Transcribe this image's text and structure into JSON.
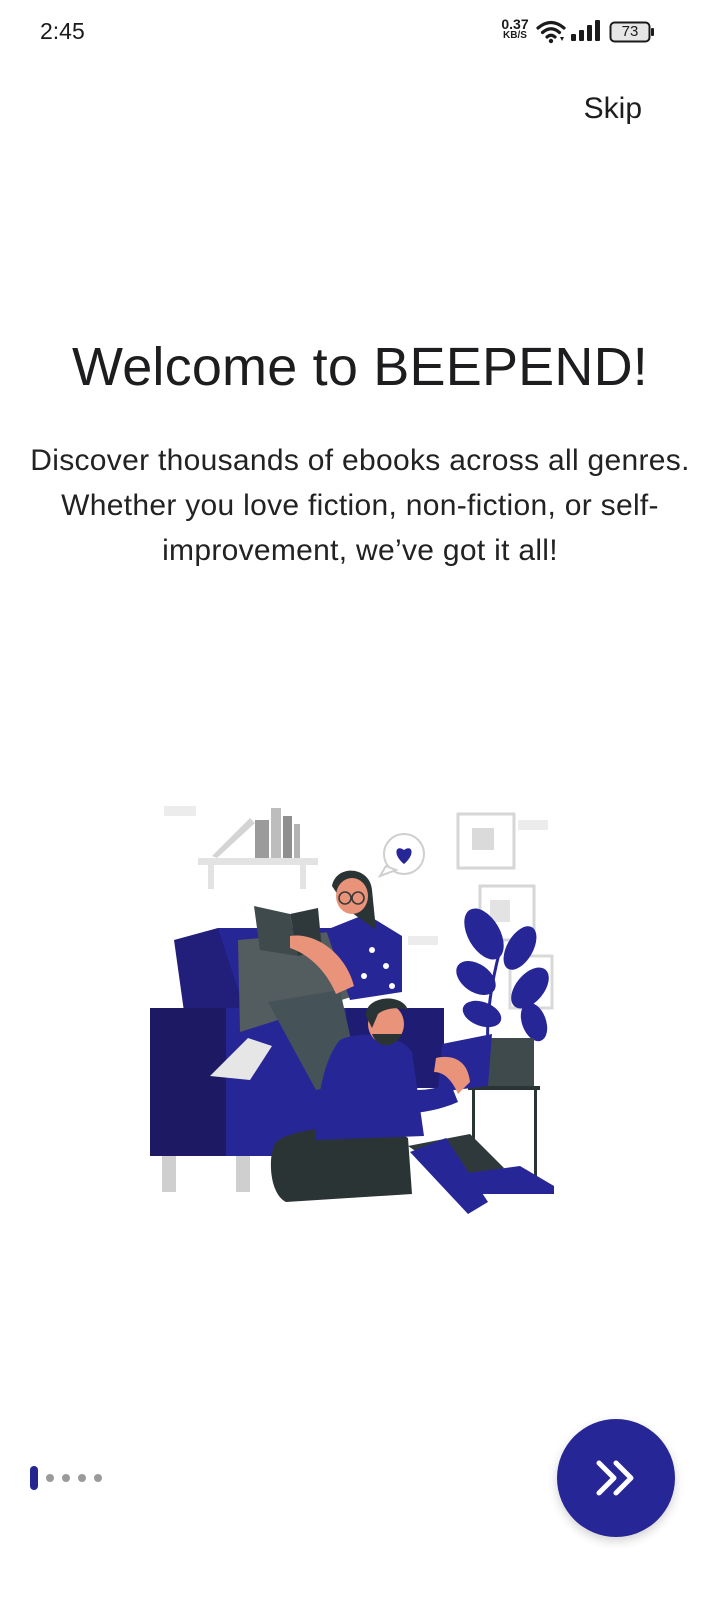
{
  "status_bar": {
    "time": "2:45",
    "net_speed_value": "0.37",
    "net_speed_unit": "KB/S",
    "battery_level": "73",
    "icons": [
      "wifi-icon",
      "signal-icon",
      "battery-icon"
    ]
  },
  "onboarding": {
    "skip_label": "Skip",
    "title": "Welcome to BEEPEND!",
    "description": "Discover thousands of ebooks across all genres. Whether you love fiction, non-fiction, or self-improvement, we’ve got it all!",
    "illustration": "reading-couple-illustration",
    "page_indicator": {
      "current": 1,
      "total": 5
    },
    "next_button_icon": "double-chevron-right-icon"
  },
  "colors": {
    "accent": "#272696",
    "accent_dark": "#1f1c74",
    "text": "#1d1d1f",
    "inactive_dot": "#9a9a9a",
    "background": "#ffffff"
  }
}
